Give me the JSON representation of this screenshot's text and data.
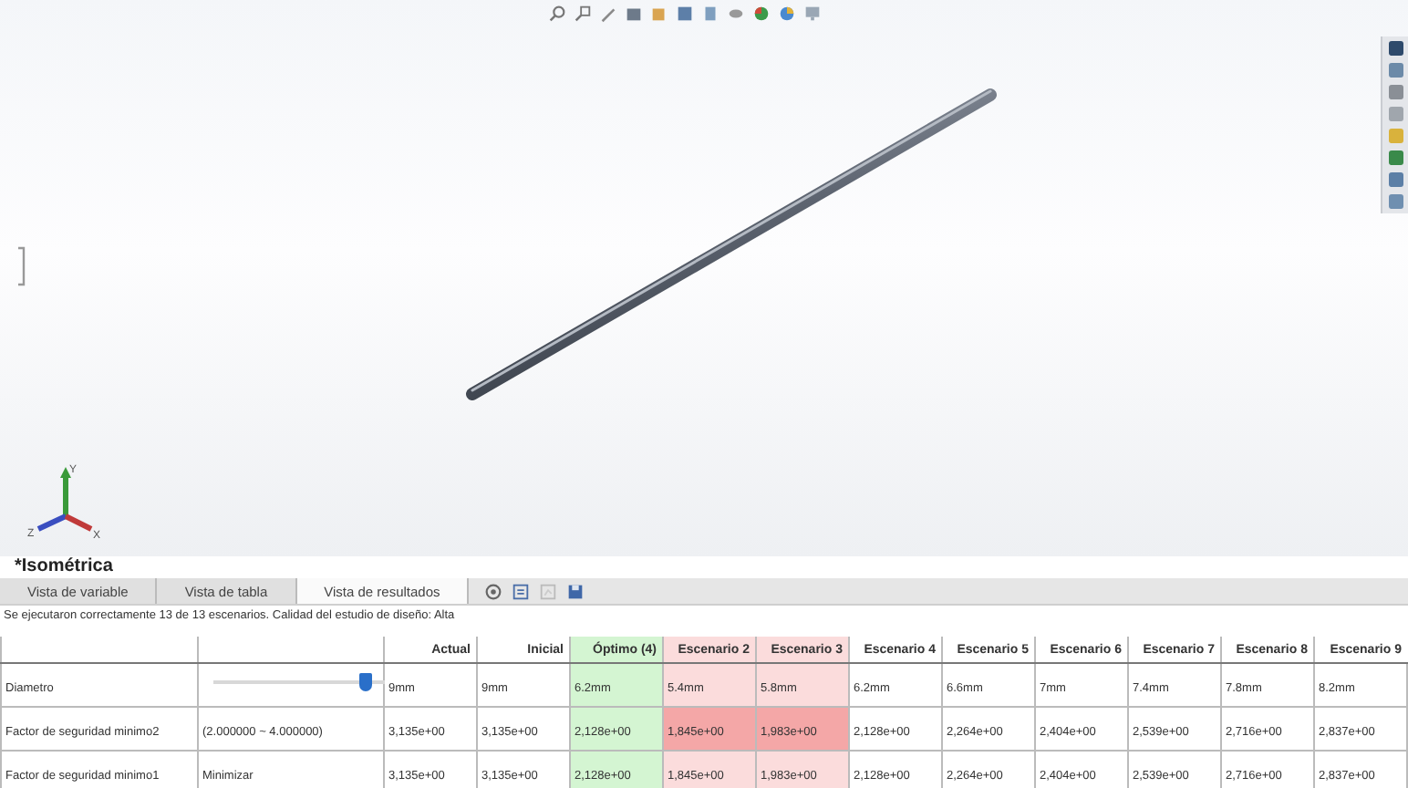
{
  "viewport": {
    "view_name": "*Isométrica",
    "triad": [
      {
        "label": "Y",
        "kind": "vertical"
      },
      {
        "label": "Z",
        "kind": "left"
      },
      {
        "label": "X",
        "kind": "right"
      }
    ]
  },
  "tabs": [
    {
      "label": "Vista de variable",
      "selected": false
    },
    {
      "label": "Vista de tabla",
      "selected": false
    },
    {
      "label": "Vista de resultados",
      "selected": true
    }
  ],
  "status_message": "Se ejecutaron correctamente 13 de 13 escenarios. Calidad del estudio de diseño: Alta",
  "table": {
    "columns": [
      {
        "label": "Actual",
        "kind": "normal"
      },
      {
        "label": "Inicial",
        "kind": "normal"
      },
      {
        "label": "Óptimo (4)",
        "kind": "optimal"
      },
      {
        "label": "Escenario 2",
        "kind": "infeasible"
      },
      {
        "label": "Escenario 3",
        "kind": "infeasible"
      },
      {
        "label": "Escenario 4",
        "kind": "normal"
      },
      {
        "label": "Escenario 5",
        "kind": "normal"
      },
      {
        "label": "Escenario 6",
        "kind": "normal"
      },
      {
        "label": "Escenario 7",
        "kind": "normal"
      },
      {
        "label": "Escenario 8",
        "kind": "normal"
      },
      {
        "label": "Escenario 9",
        "kind": "normal"
      }
    ],
    "rows": [
      {
        "name": "Diametro",
        "kind": "slider",
        "level": 0.88,
        "cells": [
          {
            "text": "9mm",
            "violated": false
          },
          {
            "text": "9mm",
            "violated": false
          },
          {
            "text": "6.2mm",
            "violated": false
          },
          {
            "text": "5.4mm",
            "violated": false
          },
          {
            "text": "5.8mm",
            "violated": false
          },
          {
            "text": "6.2mm",
            "violated": false
          },
          {
            "text": "6.6mm",
            "violated": false
          },
          {
            "text": "7mm",
            "violated": false
          },
          {
            "text": "7.4mm",
            "violated": false
          },
          {
            "text": "7.8mm",
            "violated": false
          },
          {
            "text": "8.2mm",
            "violated": false
          }
        ]
      },
      {
        "name": "Factor de seguridad minimo2",
        "kind": "text",
        "condition": "(2.000000 ~ 4.000000)",
        "cells": [
          {
            "text": "3,135e+00",
            "violated": false
          },
          {
            "text": "3,135e+00",
            "violated": false
          },
          {
            "text": "2,128e+00",
            "violated": false
          },
          {
            "text": "1,845e+00",
            "violated": true
          },
          {
            "text": "1,983e+00",
            "violated": true
          },
          {
            "text": "2,128e+00",
            "violated": false
          },
          {
            "text": "2,264e+00",
            "violated": false
          },
          {
            "text": "2,404e+00",
            "violated": false
          },
          {
            "text": "2,539e+00",
            "violated": false
          },
          {
            "text": "2,716e+00",
            "violated": false
          },
          {
            "text": "2,837e+00",
            "violated": false
          }
        ]
      },
      {
        "name": "Factor de seguridad minimo1",
        "kind": "text",
        "condition": "Minimizar",
        "cells": [
          {
            "text": "3,135e+00",
            "violated": false
          },
          {
            "text": "3,135e+00",
            "violated": false
          },
          {
            "text": "2,128e+00",
            "violated": false
          },
          {
            "text": "1,845e+00",
            "violated": false
          },
          {
            "text": "1,983e+00",
            "violated": false
          },
          {
            "text": "2,128e+00",
            "violated": false
          },
          {
            "text": "2,264e+00",
            "violated": false
          },
          {
            "text": "2,404e+00",
            "violated": false
          },
          {
            "text": "2,539e+00",
            "violated": false
          },
          {
            "text": "2,716e+00",
            "violated": false
          },
          {
            "text": "2,837e+00",
            "violated": false
          }
        ]
      }
    ]
  }
}
